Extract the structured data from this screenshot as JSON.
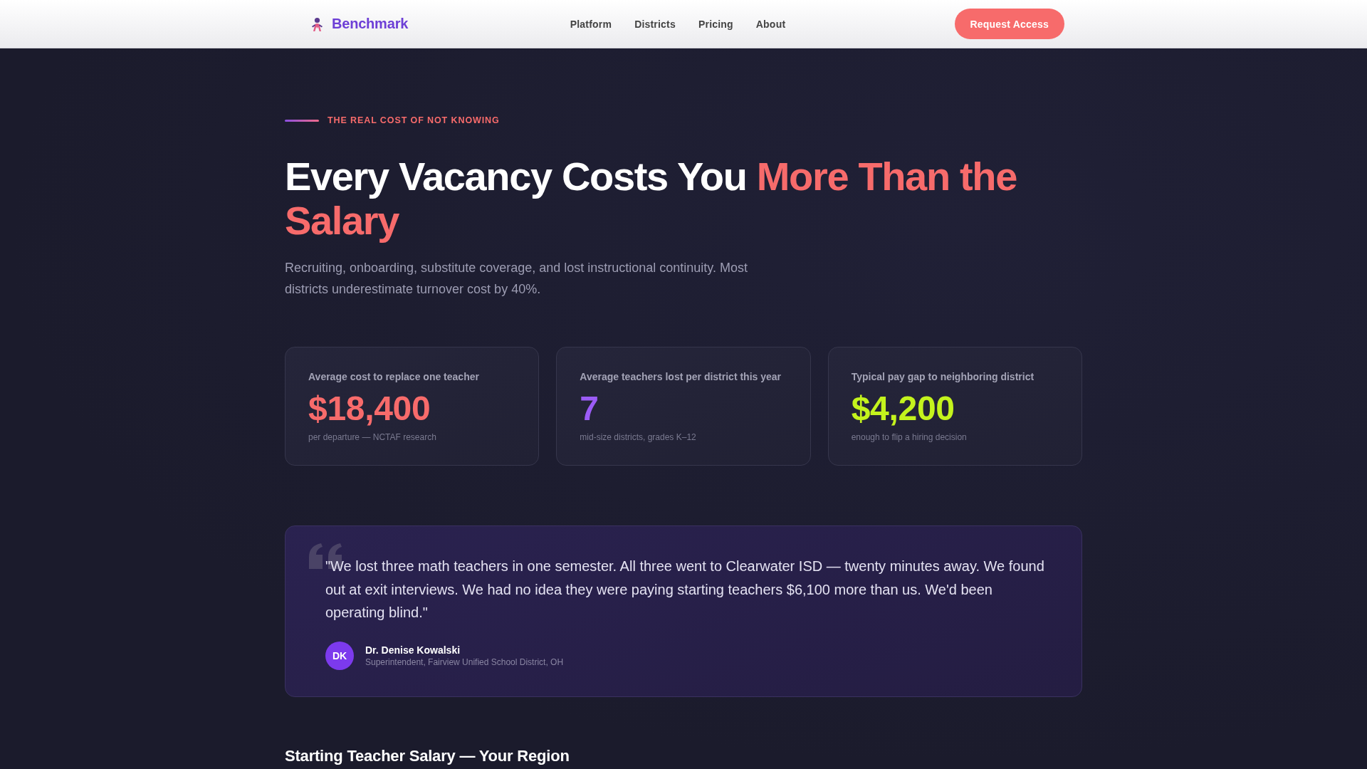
{
  "header": {
    "logo": "Benchmark",
    "nav": [
      "Platform",
      "Districts",
      "Pricing",
      "About"
    ],
    "cta": "Request Access"
  },
  "hero": {
    "eyebrow": "THE REAL COST OF NOT KNOWING",
    "headline": "Every Vacancy Costs You",
    "highlight": "More Than the Salary",
    "lede": "Recruiting, onboarding, substitute coverage, and lost instructional continuity. Most districts underestimate turnover cost by 40%."
  },
  "stats": [
    {
      "label": "Average cost to replace one teacher",
      "value": "$18,400",
      "note": "per departure — NCTAF research",
      "color": "#f76b6b"
    },
    {
      "label": "Average teachers lost per district this year",
      "value": "7",
      "note": "mid-size districts, grades K–12",
      "color": "#9b5cf6"
    },
    {
      "label": "Typical pay gap to neighboring district",
      "value": "$4,200",
      "note": "enough to flip a hiring decision",
      "color": "#c4f31d"
    }
  ],
  "testimonial": {
    "quote": "\"We lost three math teachers in one semester. All three went to Clearwater ISD — twenty minutes away. We found out at exit interviews. We had no idea they were paying starting teachers $6,100 more than us. We'd been operating blind.\"",
    "initials": "DK",
    "name": "Dr. Denise Kowalski",
    "role": "Superintendent, Fairview Unified School District, OH"
  },
  "section": {
    "title": "Starting Teacher Salary — Your Region"
  }
}
